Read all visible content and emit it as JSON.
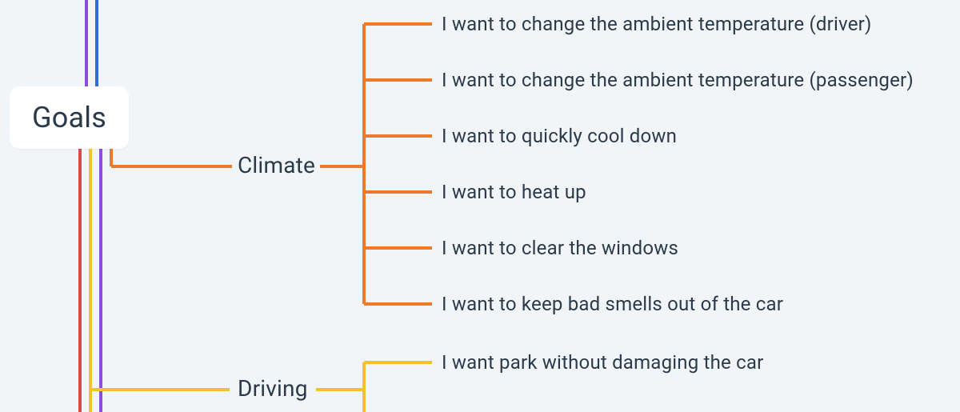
{
  "root": {
    "label": "Goals"
  },
  "categories": {
    "climate": {
      "label": "Climate",
      "color": "#ef7a2c",
      "items": [
        "I want to change the ambient temperature (driver)",
        "I want to change the ambient temperature (passenger)",
        "I want to quickly cool down",
        "I want to heat up",
        "I want to clear the windows",
        "I want to keep bad smells out of the car"
      ]
    },
    "driving": {
      "label": "Driving",
      "color": "#f2c22e",
      "items": [
        "I want park without damaging the car"
      ]
    }
  },
  "spine_colors": {
    "purple": "#8a4fd6",
    "blue": "#2a6fd6",
    "orange": "#ef7a2c",
    "yellow": "#f2c22e",
    "red": "#d64a4a"
  }
}
